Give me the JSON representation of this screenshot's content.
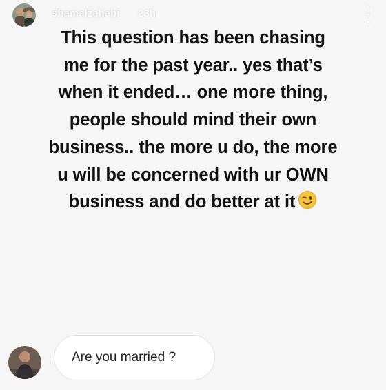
{
  "story": {
    "username": "shamalzahabi",
    "timestamp": "23h",
    "caption": "This question has been chasing me for the past year.. yes that’s when it ended… one more thing, people should mind their own business.. the more u do, the more u will be concerned with ur OWN business and do better at it",
    "caption_emoji": "winking-face-emoji",
    "question": "Are you married ?"
  },
  "icons": {
    "profile": "profile-avatar",
    "menu": "more-options-icon",
    "asker": "asker-avatar"
  },
  "colors": {
    "background": "#f6f6f6",
    "text": "#111111",
    "bubble": "#ffffff",
    "emoji": "#f7c33a"
  }
}
